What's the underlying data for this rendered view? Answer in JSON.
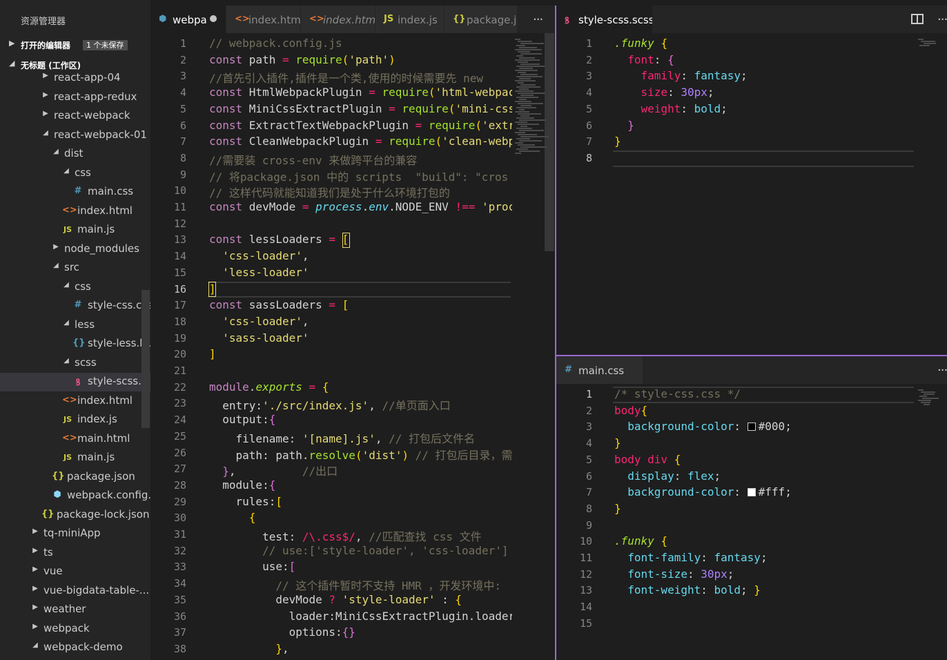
{
  "sidebar": {
    "title": "资源管理器",
    "open_editors": {
      "label": "打开的编辑器",
      "badge": "1 个未保存"
    },
    "workspace": {
      "label": "无标题 (工作区)"
    },
    "tree": [
      {
        "name": "react-app-04",
        "indent": 0,
        "type": "folder",
        "open": false
      },
      {
        "name": "react-app-redux",
        "indent": 0,
        "type": "folder",
        "open": false
      },
      {
        "name": "react-webpack",
        "indent": 0,
        "type": "folder",
        "open": false
      },
      {
        "name": "react-webpack-01",
        "indent": 0,
        "type": "folder",
        "open": true
      },
      {
        "name": "dist",
        "indent": 1,
        "type": "folder",
        "open": true
      },
      {
        "name": "css",
        "indent": 2,
        "type": "folder",
        "open": true
      },
      {
        "name": "main.css",
        "indent": 3,
        "type": "css"
      },
      {
        "name": "index.html",
        "indent": 2,
        "type": "html"
      },
      {
        "name": "main.js",
        "indent": 2,
        "type": "js"
      },
      {
        "name": "node_modules",
        "indent": 1,
        "type": "folder",
        "open": false
      },
      {
        "name": "src",
        "indent": 1,
        "type": "folder",
        "open": true
      },
      {
        "name": "css",
        "indent": 2,
        "type": "folder",
        "open": true
      },
      {
        "name": "style-css.css",
        "indent": 3,
        "type": "css"
      },
      {
        "name": "less",
        "indent": 2,
        "type": "folder",
        "open": true
      },
      {
        "name": "style-less.le...",
        "indent": 3,
        "type": "less"
      },
      {
        "name": "scss",
        "indent": 2,
        "type": "folder",
        "open": true
      },
      {
        "name": "style-scss.s...",
        "indent": 3,
        "type": "scss",
        "selected": true
      },
      {
        "name": "index.html",
        "indent": 2,
        "type": "html"
      },
      {
        "name": "index.js",
        "indent": 2,
        "type": "js"
      },
      {
        "name": "main.html",
        "indent": 2,
        "type": "html"
      },
      {
        "name": "main.js",
        "indent": 2,
        "type": "js"
      },
      {
        "name": "package.json",
        "indent": 1,
        "type": "json"
      },
      {
        "name": "webpack.config...",
        "indent": 1,
        "type": "webpack"
      },
      {
        "name": "package-lock.json",
        "indent": 0,
        "type": "json"
      },
      {
        "name": "tq-miniApp",
        "indent": -1,
        "type": "folder",
        "open": false
      },
      {
        "name": "ts",
        "indent": -1,
        "type": "folder",
        "open": false
      },
      {
        "name": "vue",
        "indent": -1,
        "type": "folder",
        "open": false
      },
      {
        "name": "vue-bigdata-table-...",
        "indent": -1,
        "type": "folder",
        "open": false
      },
      {
        "name": "weather",
        "indent": -1,
        "type": "folder",
        "open": false
      },
      {
        "name": "webpack",
        "indent": -1,
        "type": "folder",
        "open": false
      },
      {
        "name": "webpack-demo",
        "indent": -1,
        "type": "folder",
        "open": true
      }
    ]
  },
  "icons": {
    "folder_closed": "chevron-right-icon",
    "folder_open": "chevron-down-icon",
    "css": "hash-icon",
    "html": "angle-brackets-icon",
    "js": "js-icon",
    "json": "braces-icon",
    "less": "braces-icon",
    "scss": "sass-icon",
    "webpack": "cube-icon"
  },
  "left_tabs": [
    {
      "label": "webpa",
      "icon": "⬢",
      "active": true,
      "dirty": true
    },
    {
      "label": "index.htm",
      "icon": "<>",
      "active": false
    },
    {
      "label": "index.html",
      "icon": "<>",
      "active": false,
      "italic": true
    },
    {
      "label": "index.js",
      "icon": "JS",
      "active": false
    },
    {
      "label": "package.js",
      "icon": "{}",
      "active": false
    }
  ],
  "right_top_tab": {
    "label": "style-scss.scss",
    "icon": "S"
  },
  "right_bottom_tab": {
    "label": "main.css",
    "icon": "#"
  },
  "more_label": "···",
  "left_editor": {
    "current_line": 16,
    "lines": [
      [
        [
          "cm",
          "// webpack.config.js"
        ]
      ],
      [
        [
          "kw",
          "const "
        ],
        [
          "var",
          "path "
        ],
        [
          "op",
          "= "
        ],
        [
          "fn",
          "require"
        ],
        [
          "br",
          "("
        ],
        [
          "str",
          "'path'"
        ],
        [
          "br",
          ")"
        ]
      ],
      [
        [
          "cm",
          "//首先引入插件,插件是一个类,使用的时候需要先 new"
        ]
      ],
      [
        [
          "kw",
          "const "
        ],
        [
          "var",
          "HtmlWebpackPlugin "
        ],
        [
          "op",
          "= "
        ],
        [
          "fn",
          "require"
        ],
        [
          "br",
          "("
        ],
        [
          "str",
          "'html-webpac"
        ]
      ],
      [
        [
          "kw",
          "const "
        ],
        [
          "var",
          "MiniCssExtractPlugin "
        ],
        [
          "op",
          "= "
        ],
        [
          "fn",
          "require"
        ],
        [
          "br",
          "("
        ],
        [
          "str",
          "'mini-css"
        ]
      ],
      [
        [
          "kw",
          "const "
        ],
        [
          "var",
          "ExtractTextWebpackPlugin "
        ],
        [
          "op",
          "= "
        ],
        [
          "fn",
          "require"
        ],
        [
          "br",
          "("
        ],
        [
          "str",
          "'extr"
        ]
      ],
      [
        [
          "kw",
          "const "
        ],
        [
          "var",
          "CleanWebpackPlugin "
        ],
        [
          "op",
          "= "
        ],
        [
          "fn",
          "require"
        ],
        [
          "br",
          "("
        ],
        [
          "str",
          "'clean-webp"
        ]
      ],
      [
        [
          "cm",
          "//需要装 cross-env 来做跨平台的兼容"
        ]
      ],
      [
        [
          "cm",
          "// 将package.json 中的 scripts  \"build\": \"cros"
        ]
      ],
      [
        [
          "cm",
          "// 这样代码就能知道我们是处于什么环境打包的"
        ]
      ],
      [
        [
          "kw",
          "const "
        ],
        [
          "var",
          "devMode "
        ],
        [
          "op",
          "= "
        ],
        [
          "obj",
          "process"
        ],
        [
          "var",
          "."
        ],
        [
          "obj",
          "env"
        ],
        [
          "var",
          ".NODE_ENV "
        ],
        [
          "op",
          "!== "
        ],
        [
          "str",
          "'proc"
        ]
      ],
      [],
      [
        [
          "kw",
          "const "
        ],
        [
          "var",
          "lessLoaders "
        ],
        [
          "op",
          "= "
        ],
        [
          "br",
          "["
        ]
      ],
      [
        [
          "var",
          "  "
        ],
        [
          "str",
          "'css-loader'"
        ],
        [
          "var",
          ","
        ]
      ],
      [
        [
          "var",
          "  "
        ],
        [
          "str",
          "'less-loader'"
        ]
      ],
      [
        [
          "br",
          "]"
        ]
      ],
      [
        [
          "kw",
          "const "
        ],
        [
          "var",
          "sassLoaders "
        ],
        [
          "op",
          "= "
        ],
        [
          "br",
          "["
        ]
      ],
      [
        [
          "var",
          "  "
        ],
        [
          "str",
          "'css-loader'"
        ],
        [
          "var",
          ","
        ]
      ],
      [
        [
          "var",
          "  "
        ],
        [
          "str",
          "'sass-loader'"
        ]
      ],
      [
        [
          "br",
          "]"
        ]
      ],
      [],
      [
        [
          "kw",
          "module"
        ],
        [
          "var",
          "."
        ],
        [
          "cls",
          "exports "
        ],
        [
          "op",
          "= "
        ],
        [
          "br",
          "{"
        ]
      ],
      [
        [
          "var",
          "  entry:"
        ],
        [
          "str",
          "'./src/index.js'"
        ],
        [
          "var",
          ", "
        ],
        [
          "cm",
          "//单页面入口"
        ]
      ],
      [
        [
          "var",
          "  output:"
        ],
        [
          "brp",
          "{"
        ]
      ],
      [
        [
          "var",
          "    filename: "
        ],
        [
          "str",
          "'[name].js'"
        ],
        [
          "var",
          ", "
        ],
        [
          "cm",
          "// 打包后文件名"
        ]
      ],
      [
        [
          "var",
          "    path: path."
        ],
        [
          "fn",
          "resolve"
        ],
        [
          "br",
          "("
        ],
        [
          "str",
          "'dist'"
        ],
        [
          "br",
          ")"
        ],
        [
          "var",
          " "
        ],
        [
          "cm",
          "// 打包后目录，需"
        ]
      ],
      [
        [
          "var",
          "  "
        ],
        [
          "brp",
          "}"
        ],
        [
          "var",
          ",          "
        ],
        [
          "cm",
          "//出口"
        ]
      ],
      [
        [
          "var",
          "  module:"
        ],
        [
          "brp",
          "{"
        ]
      ],
      [
        [
          "var",
          "    rules:"
        ],
        [
          "br",
          "["
        ]
      ],
      [
        [
          "var",
          "      "
        ],
        [
          "br",
          "{"
        ]
      ],
      [
        [
          "var",
          "        test: "
        ],
        [
          "op",
          "/\\.css$/"
        ],
        [
          "var",
          ", "
        ],
        [
          "cm",
          "//匹配查找 css 文件"
        ]
      ],
      [
        [
          "var",
          "        "
        ],
        [
          "cm",
          "// use:['style-loader', 'css-loader']"
        ]
      ],
      [
        [
          "var",
          "        use:"
        ],
        [
          "brp",
          "["
        ]
      ],
      [
        [
          "var",
          "          "
        ],
        [
          "cm",
          "// 这个插件暂时不支持 HMR ，开发环境中:"
        ]
      ],
      [
        [
          "var",
          "          devMode "
        ],
        [
          "op",
          "? "
        ],
        [
          "str",
          "'style-loader'"
        ],
        [
          "var",
          " : "
        ],
        [
          "br",
          "{"
        ]
      ],
      [
        [
          "var",
          "            loader:MiniCssExtractPlugin.loader"
        ]
      ],
      [
        [
          "var",
          "            options:"
        ],
        [
          "brp",
          "{}"
        ]
      ],
      [
        [
          "var",
          "          "
        ],
        [
          "br",
          "}"
        ],
        [
          "var",
          ","
        ]
      ]
    ]
  },
  "right_top_editor": {
    "current_line": 8,
    "lines": [
      [
        [
          "cls",
          ".funky "
        ],
        [
          "br",
          "{"
        ]
      ],
      [
        [
          "var",
          "  "
        ],
        [
          "op",
          "font"
        ],
        [
          "var",
          ": "
        ],
        [
          "brp",
          "{"
        ]
      ],
      [
        [
          "var",
          "    "
        ],
        [
          "op",
          "family"
        ],
        [
          "var",
          ": "
        ],
        [
          "val",
          "fantasy"
        ],
        [
          "var",
          ";"
        ]
      ],
      [
        [
          "var",
          "    "
        ],
        [
          "op",
          "size"
        ],
        [
          "var",
          ": "
        ],
        [
          "num",
          "30px"
        ],
        [
          "var",
          ";"
        ]
      ],
      [
        [
          "var",
          "    "
        ],
        [
          "op",
          "weight"
        ],
        [
          "var",
          ": "
        ],
        [
          "val",
          "bold"
        ],
        [
          "var",
          ";"
        ]
      ],
      [
        [
          "var",
          "  "
        ],
        [
          "brp",
          "}"
        ]
      ],
      [
        [
          "br",
          "}"
        ]
      ],
      []
    ]
  },
  "right_bottom_editor": {
    "current_line": 1,
    "lines": [
      [
        [
          "cm",
          "/* style-css.css */"
        ]
      ],
      [
        [
          "op",
          "body"
        ],
        [
          "br",
          "{"
        ]
      ],
      [
        [
          "var",
          "  "
        ],
        [
          "val",
          "background-color"
        ],
        [
          "var",
          ": "
        ],
        [
          "sw",
          "#000000"
        ],
        [
          "var",
          "#000;"
        ]
      ],
      [
        [
          "br",
          "}"
        ]
      ],
      [
        [
          "op",
          "body div "
        ],
        [
          "br",
          "{"
        ]
      ],
      [
        [
          "var",
          "  "
        ],
        [
          "val",
          "display"
        ],
        [
          "var",
          ": "
        ],
        [
          "val",
          "flex"
        ],
        [
          "var",
          ";"
        ]
      ],
      [
        [
          "var",
          "  "
        ],
        [
          "val",
          "background-color"
        ],
        [
          "var",
          ": "
        ],
        [
          "sw",
          "#ffffff"
        ],
        [
          "var",
          "#fff;"
        ]
      ],
      [
        [
          "br",
          "}"
        ]
      ],
      [],
      [
        [
          "cls",
          ".funky "
        ],
        [
          "br",
          "{"
        ]
      ],
      [
        [
          "var",
          "  "
        ],
        [
          "val",
          "font-family"
        ],
        [
          "var",
          ": "
        ],
        [
          "val",
          "fantasy"
        ],
        [
          "var",
          ";"
        ]
      ],
      [
        [
          "var",
          "  "
        ],
        [
          "val",
          "font-size"
        ],
        [
          "var",
          ": "
        ],
        [
          "num",
          "30px"
        ],
        [
          "var",
          ";"
        ]
      ],
      [
        [
          "var",
          "  "
        ],
        [
          "val",
          "font-weight"
        ],
        [
          "var",
          ": "
        ],
        [
          "val",
          "bold"
        ],
        [
          "var",
          "; "
        ],
        [
          "br",
          "}"
        ]
      ],
      [],
      []
    ]
  },
  "colors": {
    "editor_bg": "#1e1e1e",
    "sidebar_bg": "#252526",
    "accent_border": "#9a6ad6",
    "keyword": "#c586c0",
    "string": "#e6db74",
    "comment": "#75715e"
  }
}
